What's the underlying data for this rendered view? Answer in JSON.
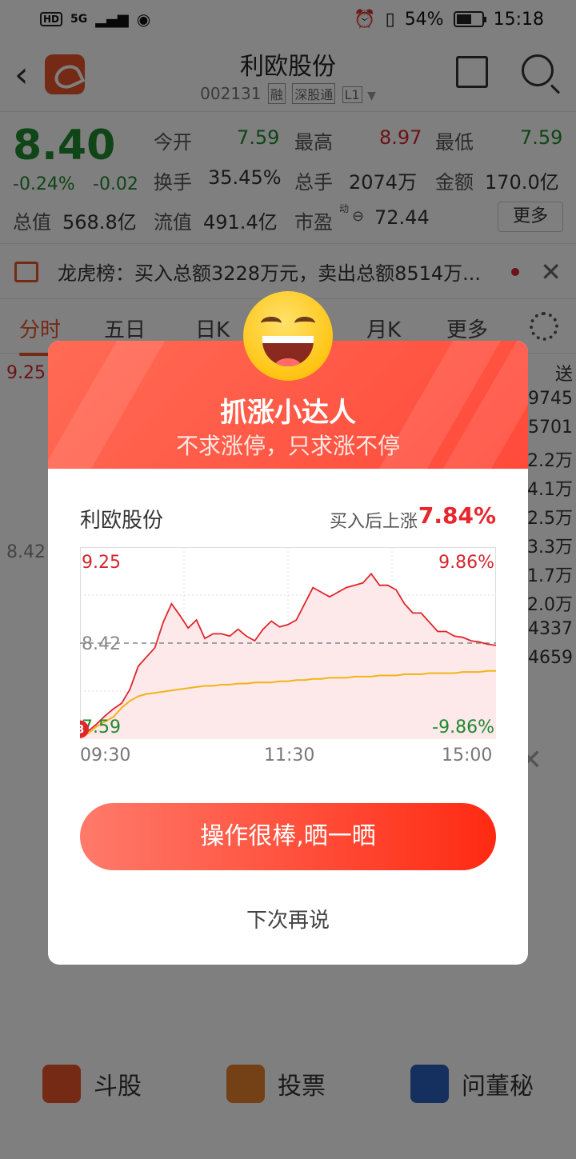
{
  "status_bar": {
    "hd": "HD",
    "net": "5G",
    "battery_pct": "54%",
    "time": "15:18"
  },
  "header": {
    "stock_name": "利欧股份",
    "stock_code": "002131",
    "tags": [
      "融",
      "深股通",
      "L1"
    ]
  },
  "quote": {
    "price": "8.40",
    "pct": "-0.24%",
    "change": "-0.02",
    "open_label": "今开",
    "open": "7.59",
    "high_label": "最高",
    "high": "8.97",
    "low_label": "最低",
    "low": "7.59",
    "turnover_label": "换手",
    "turnover": "35.45%",
    "volume_label": "总手",
    "volume": "2074万",
    "amount_label": "金额",
    "amount": "170.0亿",
    "mcap_label": "总值",
    "mcap": "568.8亿",
    "float_label": "流值",
    "float": "491.4亿",
    "pe_label": "市盈",
    "pe_sup": "动",
    "pe": "72.44",
    "more": "更多"
  },
  "notice": {
    "text": "龙虎榜：买入总额3228万元，卖出总额8514万..."
  },
  "tabs": [
    "分时",
    "五日",
    "日K",
    "月K",
    "更多"
  ],
  "bg_chart": {
    "top_price": "9.25",
    "mid_price": "8.42",
    "side_values": [
      "送",
      "9745",
      "5701",
      "2.2万",
      "4.1万",
      "2.5万",
      "3.3万",
      "1.7万",
      "2.0万",
      "4337",
      "4659"
    ]
  },
  "bottom_bar": [
    {
      "icon": "dou-gu-icon",
      "label": "斗股",
      "color": "#e8542b"
    },
    {
      "icon": "vote-icon",
      "label": "投票",
      "color": "#e8812b"
    },
    {
      "icon": "answer-icon",
      "label": "问董秘",
      "color": "#2b5fbd"
    }
  ],
  "modal": {
    "title": "抓涨小达人",
    "subtitle": "不求涨停，只求涨不停",
    "stock_name": "利欧股份",
    "rise_label": "买入后上涨",
    "rise_value": "7.84%",
    "y_top_left": "9.25",
    "y_top_right": "9.86%",
    "y_mid": "8.42",
    "y_bottom_left": "7.59",
    "y_bottom_right": "-9.86%",
    "buy_marker": "B",
    "x_labels": [
      "09:30",
      "11:30",
      "15:00"
    ],
    "share_button": "操作很棒,晒一晒",
    "later_button": "下次再说"
  },
  "chart_data": {
    "type": "line",
    "title": "",
    "xlabel": "",
    "ylabel": "",
    "x_ticks": [
      "09:30",
      "11:30",
      "15:00"
    ],
    "ylim": [
      7.59,
      9.25
    ],
    "reference": 8.42,
    "series": [
      {
        "values": [
          7.62,
          7.66,
          7.72,
          7.79,
          7.85,
          7.9,
          8.02,
          8.22,
          8.3,
          8.38,
          8.6,
          8.76,
          8.66,
          8.55,
          8.62,
          8.46,
          8.5,
          8.5,
          8.48,
          8.54,
          8.48,
          8.44,
          8.54,
          8.61,
          8.56,
          8.58,
          8.62,
          8.76,
          8.9,
          8.86,
          8.82,
          8.86,
          8.9,
          8.92,
          8.94,
          9.02,
          8.92,
          8.92,
          8.88,
          8.76,
          8.68,
          8.68,
          8.6,
          8.52,
          8.52,
          8.48,
          8.47,
          8.44,
          8.43,
          8.41,
          8.4
        ]
      },
      {
        "values": [
          7.6,
          7.64,
          7.7,
          7.74,
          7.78,
          7.86,
          7.92,
          7.96,
          7.98,
          7.99,
          8.0,
          8.01,
          8.02,
          8.03,
          8.04,
          8.05,
          8.05,
          8.06,
          8.06,
          8.07,
          8.07,
          8.08,
          8.08,
          8.08,
          8.09,
          8.09,
          8.1,
          8.1,
          8.11,
          8.11,
          8.12,
          8.12,
          8.12,
          8.13,
          8.13,
          8.13,
          8.14,
          8.14,
          8.14,
          8.15,
          8.15,
          8.15,
          8.16,
          8.16,
          8.16,
          8.16,
          8.17,
          8.17,
          8.17,
          8.18,
          8.18
        ]
      }
    ],
    "colors": {
      "price": "#e0252b",
      "avg": "#f2b418",
      "fill": "#fde8ea"
    },
    "grid": true
  }
}
